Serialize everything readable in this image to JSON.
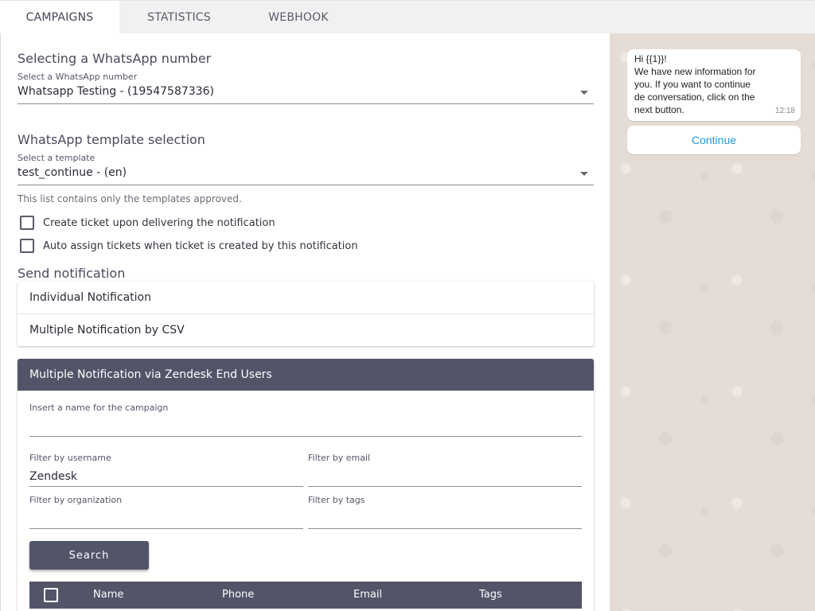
{
  "tabs": [
    {
      "label": "CAMPAIGNS",
      "active": true
    },
    {
      "label": "STATISTICS",
      "active": false
    },
    {
      "label": "WEBHOOK",
      "active": false
    }
  ],
  "number_section": {
    "title": "Selecting a WhatsApp number",
    "field_label": "Select a WhatsApp number",
    "value": "Whatsapp Testing - (19547587336)"
  },
  "template_section": {
    "title": "WhatsApp template selection",
    "field_label": "Select a template",
    "value": "test_continue - (en)",
    "hint": "This list contains only the templates approved."
  },
  "options": {
    "create_ticket": "Create ticket upon delivering the notification",
    "auto_assign": "Auto assign tickets when ticket is created by this notification"
  },
  "send": {
    "title": "Send notification",
    "items": [
      "Individual Notification",
      "Multiple Notification by CSV"
    ]
  },
  "zendesk_panel": {
    "header": "Multiple Notification via Zendesk End Users",
    "campaign_label": "Insert a name for the campaign",
    "campaign_value": "",
    "username_label": "Filter by username",
    "username_value": "Zendesk",
    "email_label": "Filter by email",
    "email_value": "",
    "organization_label": "Filter by organization",
    "organization_value": "",
    "tags_label": "Filter by tags",
    "tags_value": "",
    "search_label": "Search",
    "columns": [
      "Name",
      "Phone",
      "Email",
      "Tags"
    ]
  },
  "preview": {
    "lines": [
      "Hi {{1}}!",
      "We have new information for",
      "you. If you want to continue",
      "de conversation, click on the",
      "next button."
    ],
    "time": "12:18",
    "button": "Continue"
  },
  "colors": {
    "header_bar": "#525468",
    "preview_bg": "#e5ddd5",
    "link_blue": "#1f9bd7"
  }
}
